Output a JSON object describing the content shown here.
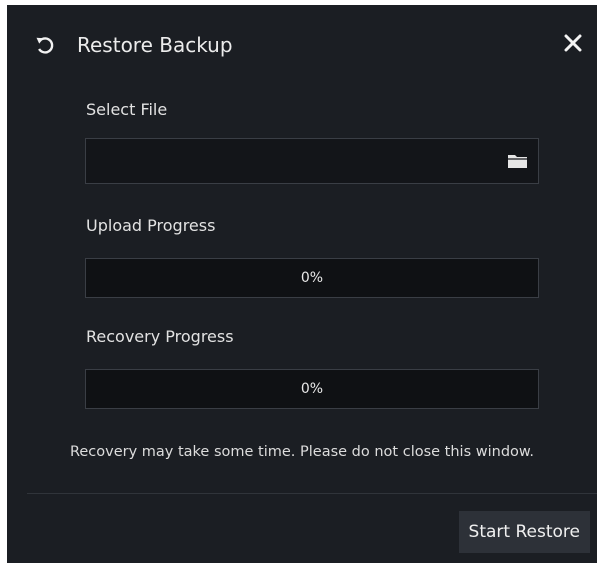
{
  "dialog": {
    "title": "Restore Backup",
    "title_icon": "restore-icon",
    "close_icon": "close-icon"
  },
  "select_file": {
    "label": "Select File",
    "value": "",
    "browse_icon": "folder-icon"
  },
  "upload_progress": {
    "label": "Upload Progress",
    "text": "0%",
    "fraction": 0
  },
  "recovery_progress": {
    "label": "Recovery Progress",
    "text": "0%",
    "fraction": 0
  },
  "notice": "Recovery may take some time. Please do not close this window.",
  "start_button": "Start Restore",
  "colors": {
    "background": "#1b1e23",
    "field": "#131519",
    "border": "#3a3e45",
    "button": "#2d3138",
    "text": "#e6e6e6"
  }
}
